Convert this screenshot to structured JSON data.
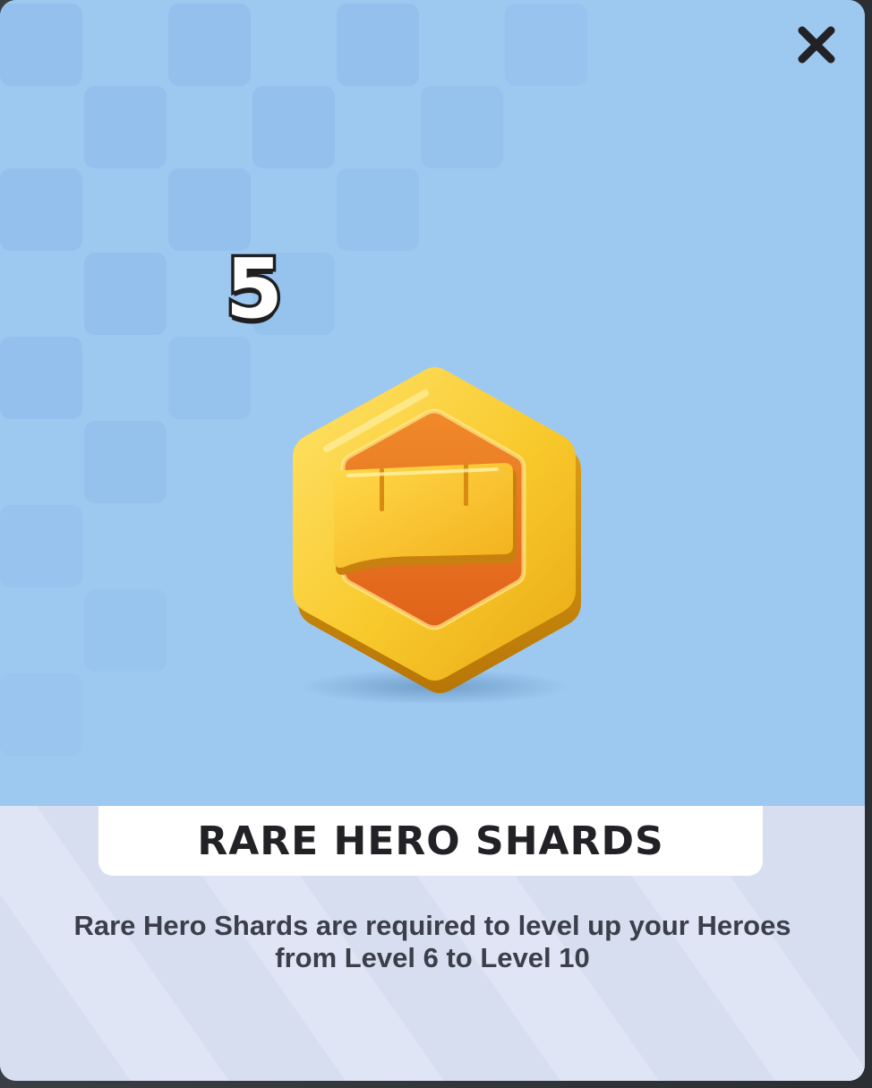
{
  "reward": {
    "quantity": "5",
    "item_icon": "rare-hero-shard-icon",
    "title": "RARE HERO SHARDS",
    "description_line1": "Rare Hero Shards are required to level up your Heroes",
    "description_line2": "from Level 6 to Level 10"
  },
  "controls": {
    "close_icon": "close-icon"
  },
  "colors": {
    "hero_background": "#9dc8f0",
    "info_background": "#d7def0",
    "shard_gold": "#f5c62c",
    "shard_orange": "#ec7a1f",
    "title_text": "#222226"
  }
}
